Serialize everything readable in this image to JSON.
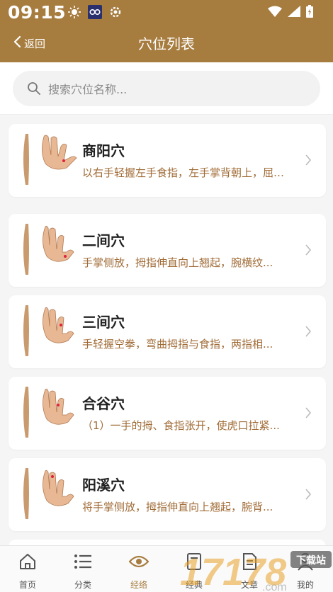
{
  "status_bar": {
    "time": "09:15"
  },
  "header": {
    "back_label": "返回",
    "title": "穴位列表"
  },
  "search": {
    "placeholder": "搜索穴位名称..."
  },
  "acupoints": [
    {
      "name": "商阳穴",
      "desc": "以右手轻握左手食指，左手掌背朝上，屈食指，在食指指甲..."
    },
    {
      "name": "二间穴",
      "desc": "手掌侧放，拇指伸直向上翘起，腕横纹..."
    },
    {
      "name": "三间穴",
      "desc": "手轻握空拳，弯曲拇指与食指，两指相..."
    },
    {
      "name": "合谷穴",
      "desc": "（1）一手的拇、食指张开，使虎口拉紧..."
    },
    {
      "name": "阳溪穴",
      "desc": "将手掌侧放，拇指伸直向上翘起，腕背..."
    }
  ],
  "tabbar": {
    "tabs": [
      {
        "label": "首页",
        "icon": "home-icon"
      },
      {
        "label": "分类",
        "icon": "list-icon"
      },
      {
        "label": "经络",
        "icon": "eye-icon",
        "active": true
      },
      {
        "label": "经典",
        "icon": "book-icon"
      },
      {
        "label": "文章",
        "icon": "article-icon"
      },
      {
        "label": "我的",
        "icon": "user-icon"
      }
    ]
  },
  "watermark": {
    "text": "17178.com",
    "badge": "下载站"
  },
  "colors": {
    "brand": "#a77c3f",
    "desc_text": "#a06b36",
    "background": "#f5f5f5"
  }
}
